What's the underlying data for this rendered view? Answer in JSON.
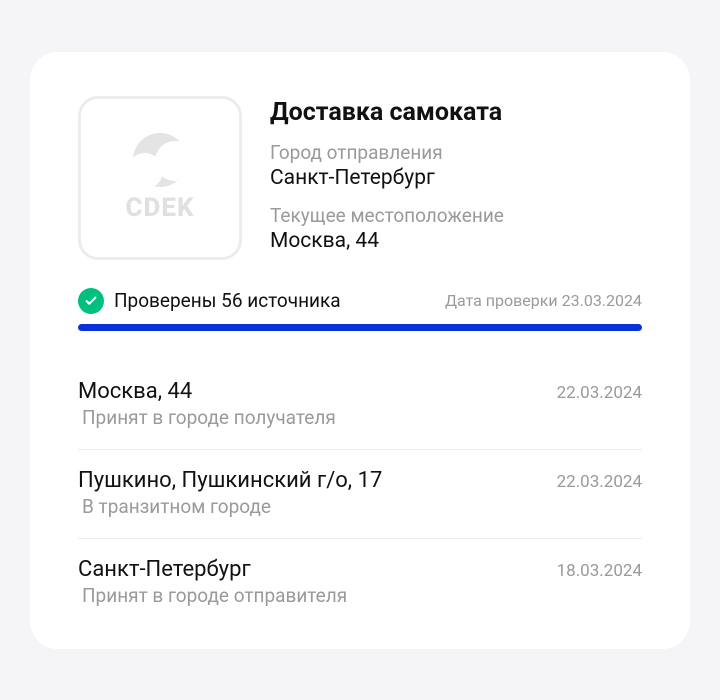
{
  "logo": {
    "brand": "CDEK"
  },
  "title": "Доставка самоката",
  "origin": {
    "label": "Город отправления",
    "value": "Санкт-Петербург"
  },
  "current": {
    "label": "Текущее местоположение",
    "value": "Москва, 44"
  },
  "status": {
    "text": "Проверены 56 источника",
    "date_label": "Дата проверки 23.03.2024",
    "progress_pct": 100,
    "accent_color": "#0932d8",
    "check_color": "#00c07f"
  },
  "events": [
    {
      "location": "Москва, 44",
      "date": "22.03.2024",
      "status": "Принят в городе получателя"
    },
    {
      "location": "Пушкино, Пушкинский г/о, 17",
      "date": "22.03.2024",
      "status": "В транзитном городе"
    },
    {
      "location": "Санкт-Петербург",
      "date": "18.03.2024",
      "status": "Принят в городе отправителя"
    }
  ]
}
